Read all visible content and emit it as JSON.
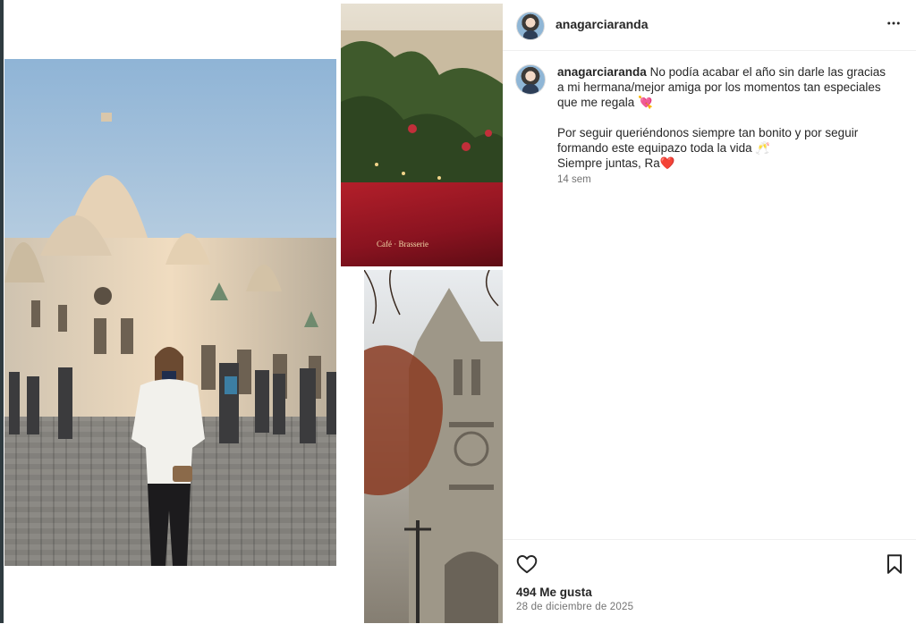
{
  "post": {
    "username": "anagarciaranda",
    "caption": {
      "username": "anagarciaranda",
      "line1": "No podía acabar el año sin darle las gracias a mi hermana/mejor amiga por los momentos tan especiales que me regala 💘",
      "line2": "Por seguir queriéndonos siempre tan bonito y por seguir formando este equipazo toda la vida 🥂",
      "line3": "Siempre juntas, Ra❤️",
      "time": "14 sem"
    },
    "likes": "494 Me gusta",
    "date": "28 de diciembre de 2025"
  },
  "photos": {
    "p2_sign": "Café · Brasserie"
  },
  "icons": {
    "more": "more-options-icon",
    "like": "heart-icon",
    "save": "bookmark-icon"
  },
  "colors": {
    "text": "#262626",
    "secondary": "#737373",
    "divider": "#efefef"
  }
}
